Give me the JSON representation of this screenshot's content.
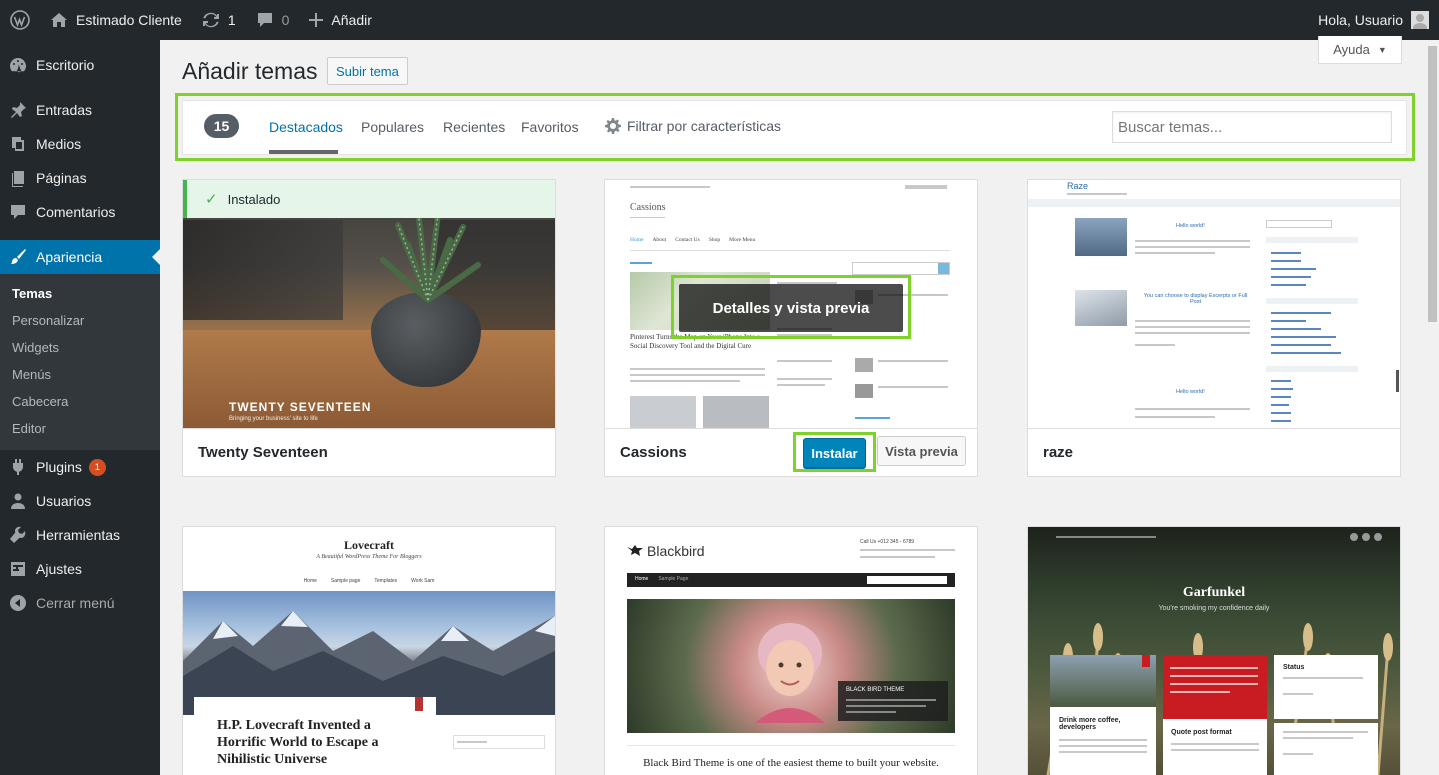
{
  "adminbar": {
    "site_name": "Estimado Cliente",
    "updates_count": "1",
    "comments_count": "0",
    "add_new": "Añadir",
    "greeting": "Hola, Usuario"
  },
  "sidebar": {
    "items": [
      {
        "label": "Escritorio",
        "icon": "dashboard-icon"
      },
      {
        "label": "Entradas",
        "icon": "pushpin-icon"
      },
      {
        "label": "Medios",
        "icon": "media-icon"
      },
      {
        "label": "Páginas",
        "icon": "page-icon"
      },
      {
        "label": "Comentarios",
        "icon": "comment-icon"
      },
      {
        "label": "Apariencia",
        "icon": "brush-icon"
      }
    ],
    "submenu": [
      "Temas",
      "Personalizar",
      "Widgets",
      "Menús",
      "Cabecera",
      "Editor"
    ],
    "items2": [
      {
        "label": "Plugins",
        "icon": "plugin-icon",
        "badge": "1"
      },
      {
        "label": "Usuarios",
        "icon": "users-icon"
      },
      {
        "label": "Herramientas",
        "icon": "wrench-icon"
      },
      {
        "label": "Ajustes",
        "icon": "settings-icon"
      }
    ],
    "collapse": "Cerrar menú"
  },
  "main": {
    "help": "Ayuda",
    "title": "Añadir temas",
    "upload": "Subir tema"
  },
  "filter": {
    "count": "15",
    "tabs": [
      "Destacados",
      "Populares",
      "Recientes",
      "Favoritos"
    ],
    "feature_filter": "Filtrar por características",
    "search_placeholder": "Buscar temas..."
  },
  "themes": [
    {
      "name": "Twenty Seventeen",
      "status": "Instalado",
      "shot_title": "TWENTY SEVENTEEN",
      "shot_sub": "Bringing your business' site to life"
    },
    {
      "name": "Cassions",
      "overlay": "Detalles y vista previa",
      "install": "Instalar",
      "preview": "Vista previa",
      "shot_title": "Cassions",
      "shot_nav": [
        "Home",
        "About",
        "Contact Us",
        "Shop",
        "More Menu"
      ],
      "shot_post": "Pinterest Turns the Map on Your iPhone Into a Social Discovery Tool and the Digital Cure"
    },
    {
      "name": "raze",
      "shot_title": "Raze",
      "shot_post1": "Hello world!",
      "shot_post2": "You can choose to display Excerpts or Full Post",
      "shot_post3": "Hello world!"
    },
    {
      "name": "Lovecraft",
      "shot_title": "Lovecraft",
      "shot_sub": "A Beautiful WordPress Theme For Bloggers",
      "shot_nav": [
        "Home",
        "Sample page",
        "Templates",
        "Work Sam"
      ],
      "shot_post": "H.P. Lovecraft Invented a Horrific World to Escape a Nihilistic Universe"
    },
    {
      "name": "Blackbird",
      "shot_title": "Blackbird",
      "shot_nav": [
        "Home",
        "Sample Page"
      ],
      "shot_caption": "BLACK BIRD THEME",
      "shot_text": "Black Bird Theme is one of the easiest theme to built your website.",
      "shot_contact": "Call Us +012 345 - 6789"
    },
    {
      "name": "Garfunkel",
      "shot_title": "Garfunkel",
      "shot_sub": "You're smoking my confidence daily",
      "shot_card1": "Drink more coffee, developers",
      "shot_card2": "Quote post format",
      "shot_card3": "Status"
    }
  ]
}
